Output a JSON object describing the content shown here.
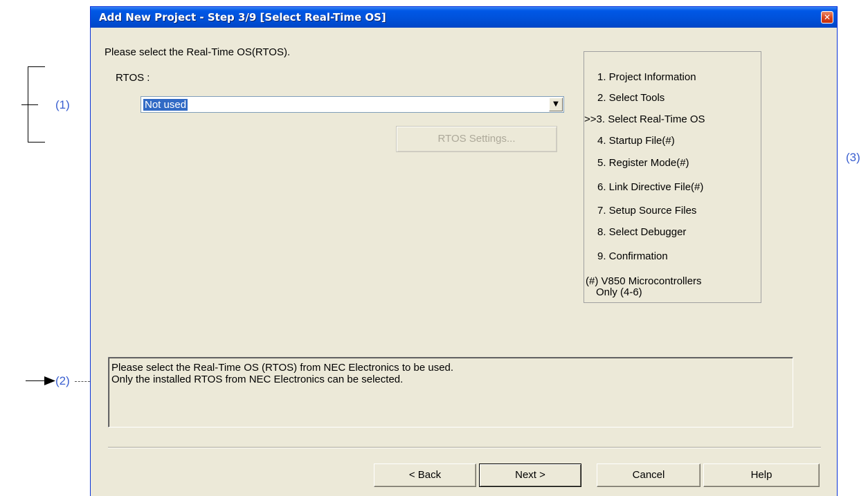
{
  "dialog": {
    "title": "Add New Project - Step 3/9 [Select Real-Time OS]",
    "close_glyph": "✕",
    "instruction": "Please select the Real-Time OS(RTOS).",
    "rtos_label": "RTOS :",
    "rtos_selected": "Not used",
    "rtos_settings_button": "RTOS Settings...",
    "steps": [
      "1. Project Information",
      "2. Select Tools",
      ">>3. Select Real-Time OS",
      "4. Startup File(#)",
      "5. Register Mode(#)",
      "6. Link Directive File(#)",
      "7. Setup Source Files",
      "8. Select Debugger",
      "9. Confirmation"
    ],
    "steps_note_line1": "(#) V850 Microcontrollers",
    "steps_note_line2": "Only (4-6)",
    "description_line1": "Please select the Real-Time OS (RTOS) from NEC Electronics to be used.",
    "description_line2": "Only the installed RTOS from NEC Electronics can be selected.",
    "buttons": {
      "back": "< Back",
      "next": "Next >",
      "cancel": "Cancel",
      "help": "Help"
    },
    "current_step": 3,
    "total_steps": 9
  },
  "annotations": {
    "label_1": "(1)",
    "label_2": "(2)",
    "label_3": "(3)"
  },
  "colors": {
    "titlebar": "#0050d8",
    "dialog_bg": "#ece9d8",
    "selection": "#316ac5",
    "annotation": "#3a5fd0",
    "close_button": "#d8431c"
  },
  "icons": {
    "close": "close-icon",
    "dropdown": "chevron-down-icon",
    "annotation_arrow": "arrow-icon"
  }
}
